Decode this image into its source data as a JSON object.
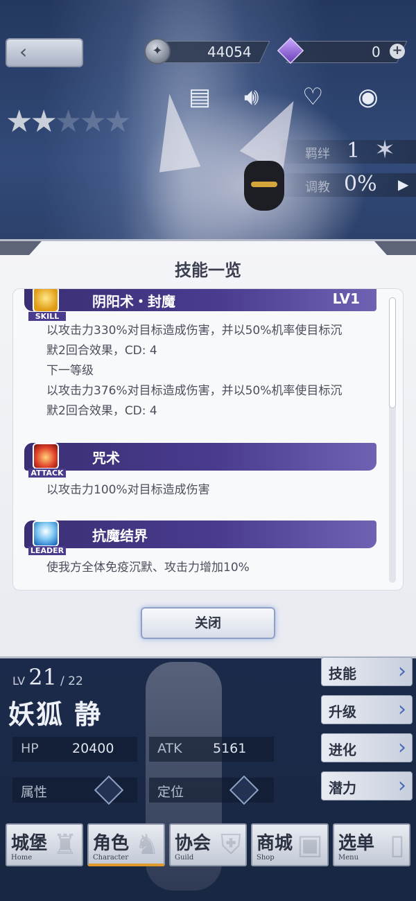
{
  "top_bar": {
    "back_label": "‹",
    "coins": "44054",
    "gems": "0",
    "plus": "+"
  },
  "hero": {
    "stars_filled": 2,
    "stars_total": 5,
    "bond_label": "羁绊",
    "bond_value": "1",
    "train_label": "调教",
    "train_value": "0%"
  },
  "modal": {
    "title": "技能一览",
    "skills": [
      {
        "icon_tag": "SKILL",
        "name": "阴阳术・封魔",
        "level": "LV1",
        "desc_lines": [
          "以攻击力330%对目标造成伤害，并以50%机率使目标沉",
          "默2回合效果，CD: 4",
          "下一等级",
          "以攻击力376%对目标造成伤害，并以50%机率使目标沉",
          "默2回合效果，CD: 4"
        ]
      },
      {
        "icon_tag": "ATTACK",
        "name": "咒术",
        "level": "",
        "desc_lines": [
          "以攻击力100%对目标造成伤害"
        ]
      },
      {
        "icon_tag": "LEADER",
        "name": "抗魔结界",
        "level": "",
        "desc_lines": [
          "使我方全体免疫沉默、攻击力增加10%"
        ]
      }
    ],
    "close_label": "关闭"
  },
  "character": {
    "lv_label": "LV",
    "lv_current": "21",
    "lv_max": "/ 22",
    "name": "妖狐 静",
    "hp_label": "HP",
    "hp_value": "20400",
    "atk_label": "ATK",
    "atk_value": "5161",
    "attr_label": "属性",
    "role_label": "定位"
  },
  "side_menu": [
    {
      "label": "技能"
    },
    {
      "label": "升级"
    },
    {
      "label": "进化"
    },
    {
      "label": "潜力"
    }
  ],
  "bottom_nav": [
    {
      "cn": "城堡",
      "en": "Home"
    },
    {
      "cn": "角色",
      "en": "Character"
    },
    {
      "cn": "协会",
      "en": "Guild"
    },
    {
      "cn": "商城",
      "en": "Shop"
    },
    {
      "cn": "选单",
      "en": "Menu"
    }
  ],
  "colors": {
    "accent_purple": "#4a3b8e",
    "active_tab": "#e09a2b"
  }
}
